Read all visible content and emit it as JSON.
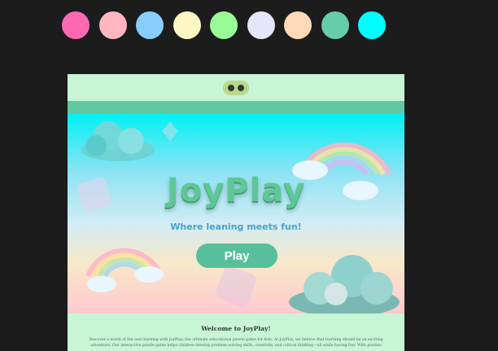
{
  "palette": [
    "#ff69b4",
    "#ffb6c1",
    "#87cefa",
    "#fff8c6",
    "#98fb98",
    "#e6e6fa",
    "#ffdab9",
    "#66cdaa",
    "#00ffff"
  ],
  "hero": {
    "title": "JoyPlay",
    "tagline": "Where leaning meets fun!",
    "play_label": "Play"
  },
  "content": {
    "heading": "Welcome to JoyPlay!",
    "description": "Discover a world of fun and learning with JoyPlay, the ultimate educational puzzle game for kids. At JoyPlay, we believe that learning should be an exciting adventure. Our interactive puzzle game helps children develop problem-solving skills, creativity, and critical thinking—all while having fun! With puzzles"
  }
}
